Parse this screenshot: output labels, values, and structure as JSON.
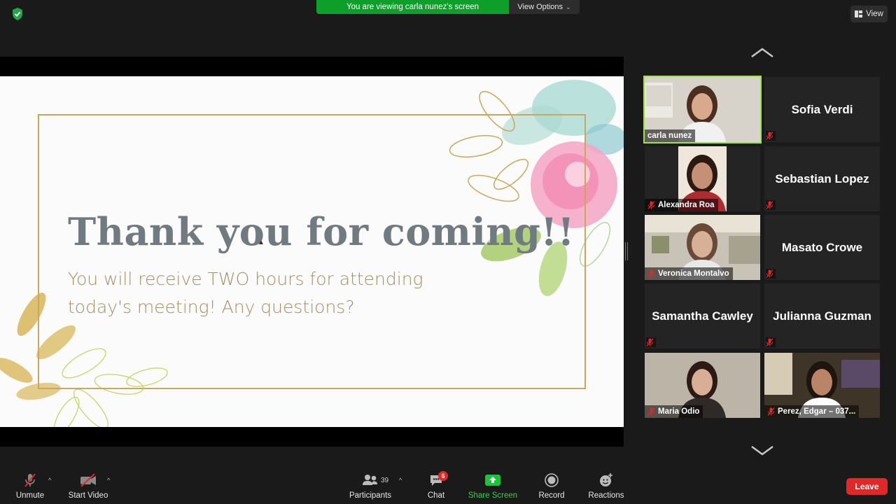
{
  "topbar": {
    "banner_text": "You are viewing carla nunez's screen",
    "view_options_label": "View Options",
    "view_label": "View"
  },
  "slide": {
    "title": "Thank you for coming!!",
    "subtitle": "You will receive TWO hours for attending today's meeting! Any questions?"
  },
  "participants": [
    {
      "name": "carla nunez",
      "video": true,
      "active": true,
      "muted": false
    },
    {
      "name": "Sofia Verdi",
      "video": false,
      "muted": true
    },
    {
      "name": "Alexandra Roa",
      "video": true,
      "muted": true
    },
    {
      "name": "Sebastian Lopez",
      "video": false,
      "muted": true
    },
    {
      "name": "Veronica Montalvo",
      "video": true,
      "muted": true
    },
    {
      "name": "Masato Crowe",
      "video": false,
      "muted": true
    },
    {
      "name": "Samantha Cawley",
      "video": false,
      "muted": true
    },
    {
      "name": "Julianna Guzman",
      "video": false,
      "muted": true
    },
    {
      "name": "Maria Odio",
      "video": true,
      "muted": true
    },
    {
      "name": "Perez, Edgar – 037...",
      "video": true,
      "muted": true
    }
  ],
  "toolbar": {
    "unmute": "Unmute",
    "start_video": "Start Video",
    "participants": "Participants",
    "participant_count": "39",
    "chat": "Chat",
    "chat_badge": "6",
    "share_screen": "Share Screen",
    "record": "Record",
    "reactions": "Reactions",
    "leave": "Leave"
  },
  "colors": {
    "share_green": "#0e9f2b",
    "active_speaker": "#9be53c",
    "leave_red": "#e02828",
    "title_gray": "#6f7b80",
    "subtitle_gold": "#a88f62"
  }
}
